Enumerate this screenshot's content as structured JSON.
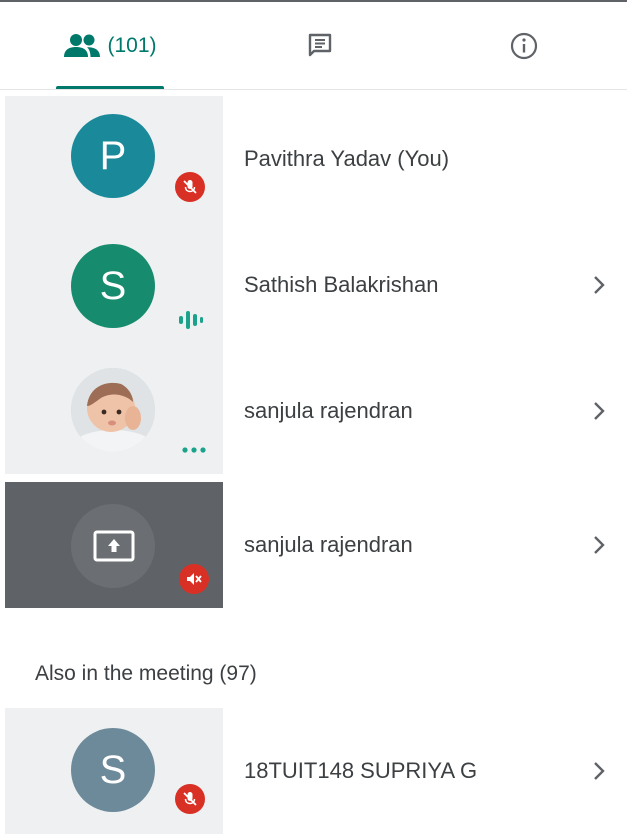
{
  "tabs": {
    "people_count": "(101)",
    "people_icon": "people-icon",
    "chat_icon": "chat-icon",
    "info_icon": "info-icon",
    "accent": "#00796b"
  },
  "participants": [
    {
      "initial": "P",
      "name": "Pavithra Yadav (You)",
      "color": "#1a8a9a",
      "status": "muted"
    },
    {
      "initial": "S",
      "name": "Sathish Balakrishan",
      "color": "#168b6e",
      "status": "speaking"
    },
    {
      "initial": "",
      "name": "sanjula rajendran",
      "status": "more"
    },
    {
      "initial": "",
      "name": "sanjula rajendran",
      "status": "presenting-muted"
    }
  ],
  "also_in_meeting": {
    "heading": "Also in the meeting (97)",
    "items": [
      {
        "initial": "S",
        "name": "18TUIT148 SUPRIYA G",
        "color": "#6d8a9a",
        "status": "muted"
      }
    ]
  }
}
